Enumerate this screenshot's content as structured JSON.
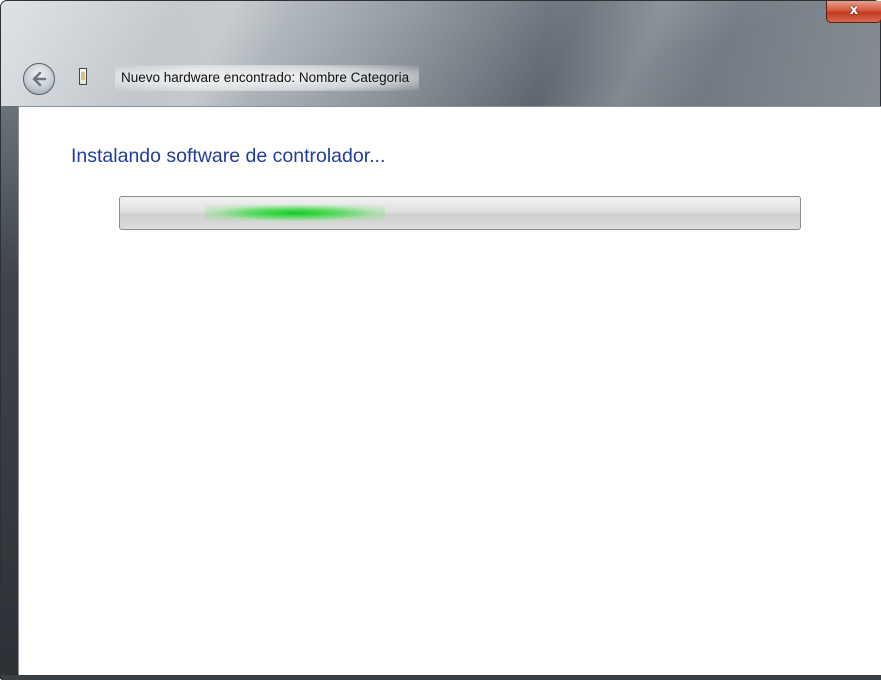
{
  "window": {
    "title": "Nuevo hardware encontrado: Nombre Categoria",
    "close_label": "x",
    "accent_color": "#1f3d9a",
    "close_color": "#c13a1f"
  },
  "icons": {
    "back": "back-arrow-icon",
    "device": "hardware-device-icon",
    "close": "close-icon"
  },
  "main": {
    "heading": "Instalando software de controlador...",
    "progress": {
      "mode": "indeterminate",
      "fill_color": "#16c828"
    }
  }
}
